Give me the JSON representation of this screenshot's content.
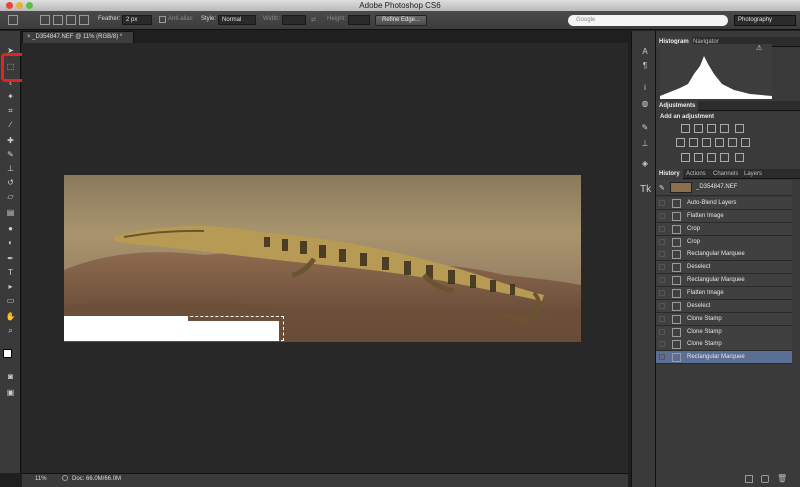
{
  "window": {
    "title": "Adobe Photoshop CS6"
  },
  "options_bar": {
    "feather_label": "Feather:",
    "feather_value": "2 px",
    "antialias_label": "Anti-alias",
    "style_label": "Style:",
    "style_value": "Normal",
    "width_label": "Width:",
    "height_label": "Height:",
    "refine_edge": "Refine Edge...",
    "search_placeholder": "Google",
    "workspace": "Photography"
  },
  "document": {
    "tab_title": "_D354847.NEF @ 11% (RGB/8) *",
    "zoom": "11%",
    "doc_size": "Doc: 66.0M/66.0M"
  },
  "panels": {
    "top_tabs": [
      "Histogram",
      "Navigator"
    ],
    "adjustments_tab": "Adjustments",
    "add_adjustment": "Add an adjustment",
    "history_tabs": [
      "History",
      "Actions",
      "Channels",
      "Layers"
    ],
    "snapshot_name": "_D354847.NEF"
  },
  "history": [
    {
      "label": "Auto-Blend Layers",
      "icon": "layers-icon"
    },
    {
      "label": "Flatten Image",
      "icon": "layers-icon"
    },
    {
      "label": "Crop",
      "icon": "crop-icon"
    },
    {
      "label": "Crop",
      "icon": "crop-icon"
    },
    {
      "label": "Rectangular Marquee",
      "icon": "marquee-icon"
    },
    {
      "label": "Deselect",
      "icon": "marquee-icon"
    },
    {
      "label": "Rectangular Marquee",
      "icon": "marquee-icon"
    },
    {
      "label": "Flatten Image",
      "icon": "layers-icon"
    },
    {
      "label": "Deselect",
      "icon": "marquee-icon"
    },
    {
      "label": "Clone Stamp",
      "icon": "stamp-icon"
    },
    {
      "label": "Clone Stamp",
      "icon": "stamp-icon"
    },
    {
      "label": "Clone Stamp",
      "icon": "stamp-icon"
    },
    {
      "label": "Rectangular Marquee",
      "icon": "marquee-icon",
      "selected": true
    }
  ],
  "colors": {
    "highlight": "#e0241f",
    "history_selected": "#5a6f93"
  }
}
